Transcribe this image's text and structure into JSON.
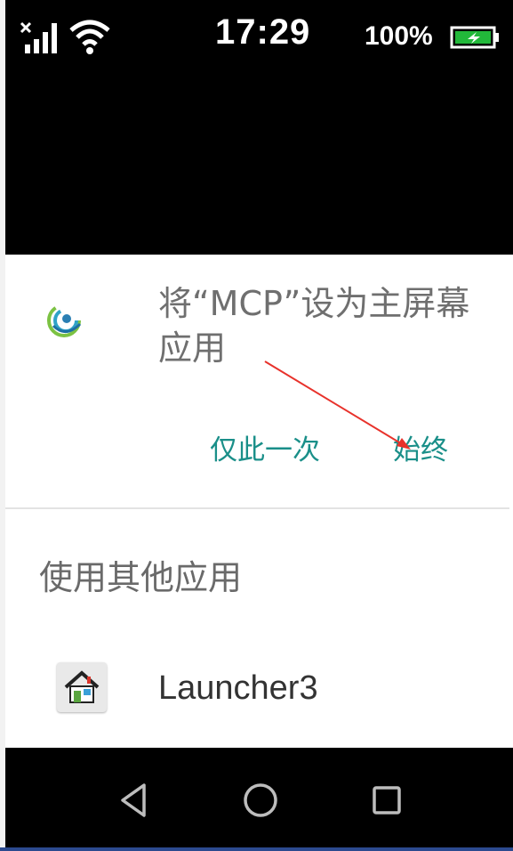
{
  "status_bar": {
    "time": "17:29",
    "battery_percent": "100%",
    "icons": [
      "signal-no-sim-icon",
      "wifi-icon",
      "battery-charging-icon"
    ]
  },
  "dialog": {
    "title": "将“MCP”设为主屏幕应用",
    "app_icon": "mcp-app-icon",
    "buttons": {
      "once": "仅此一次",
      "always": "始终"
    },
    "other_apps_title": "使用其他应用",
    "other_apps": [
      {
        "label": "Launcher3",
        "icon": "launcher-house-icon"
      }
    ]
  },
  "nav_bar": {
    "icons": [
      "back-icon",
      "home-icon",
      "recents-icon"
    ]
  },
  "colors": {
    "accent": "#1a8f89",
    "annotation_arrow": "#e8322b",
    "title_text": "#6f6f6f"
  }
}
